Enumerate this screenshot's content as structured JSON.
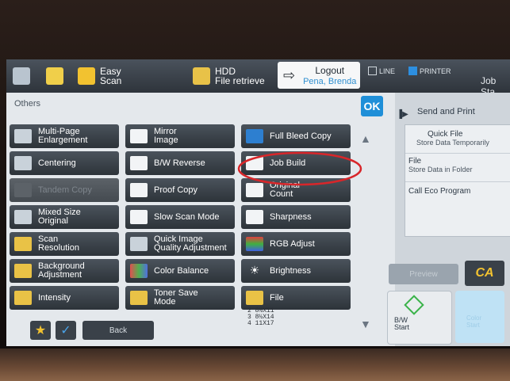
{
  "topbar": {
    "easy_scan": "Easy\nScan",
    "hdd": "HDD\nFile retrieve",
    "logout_title": "Logout",
    "logout_user": "Pena, Brenda",
    "line": "LINE",
    "printer": "PRINTER",
    "job_status": "Job Sta"
  },
  "left": {
    "title": "Others",
    "ok": "OK",
    "cells": [
      "Multi-Page\nEnlargement",
      "Mirror\nImage",
      "Full Bleed Copy",
      "Centering",
      "B/W Reverse",
      "Job Build",
      "Tandem Copy",
      "Proof Copy",
      "Original\nCount",
      "Mixed Size\nOriginal",
      "Slow Scan Mode",
      "Sharpness",
      "Scan\nResolution",
      "Quick Image\nQuality Adjustment",
      "RGB Adjust",
      "Background\nAdjustment",
      "Color Balance",
      "Brightness",
      "Intensity",
      "Toner Save\nMode",
      "File"
    ],
    "back": "Back",
    "paper_list": [
      "2  8½X11",
      "3  8½X14",
      "4  11X17"
    ]
  },
  "right": {
    "send_print": "Send and Print",
    "items": [
      {
        "title": "Quick File",
        "sub": "Store Data Temporarily"
      },
      {
        "title": "File",
        "sub": "Store Data in Folder"
      },
      {
        "title": "Call Eco Program",
        "sub": ""
      }
    ],
    "preview": "Preview",
    "ca": "CA",
    "bw_start": "B/W\nStart",
    "color_start": "Color\nStart"
  },
  "colors": {
    "accent": "#1f8fd8",
    "annotation": "#d8262a"
  }
}
